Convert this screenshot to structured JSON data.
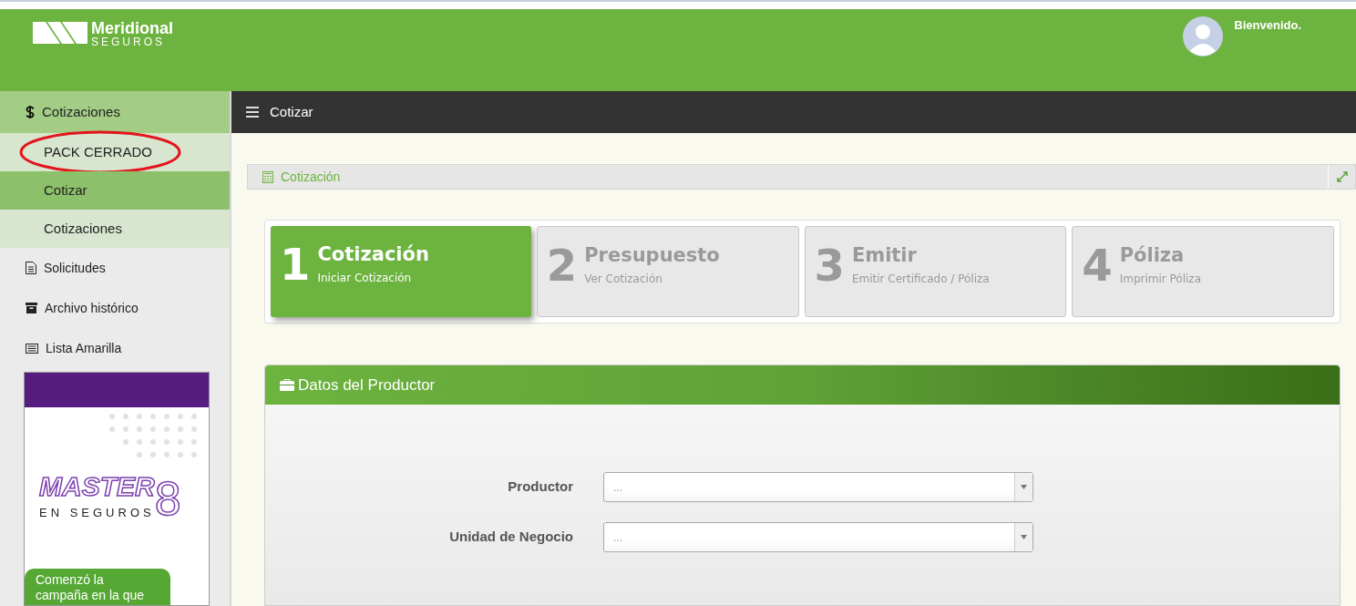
{
  "header": {
    "logo_name": "Meridional",
    "logo_sub": "SEGUROS",
    "greeting": "Bienvenido."
  },
  "sidebar": {
    "items": [
      {
        "kind": "group",
        "label": "Cotizaciones",
        "selected": false
      },
      {
        "kind": "sub",
        "label": "PACK CERRADO",
        "selected": false,
        "circled": true
      },
      {
        "kind": "sub",
        "label": "Cotizar",
        "selected": true,
        "circled": false
      },
      {
        "kind": "sub",
        "label": "Cotizaciones",
        "selected": false,
        "circled": false
      },
      {
        "kind": "item",
        "label": "Solicitudes",
        "selected": false
      },
      {
        "kind": "item",
        "label": "Archivo histórico",
        "selected": false
      },
      {
        "kind": "item",
        "label": "Lista Amarilla",
        "selected": false
      }
    ],
    "banner": {
      "title": "MASTER",
      "number": "8",
      "subtitle": "EN SEGUROS",
      "message": "Comenzó la campaña en la que"
    }
  },
  "toolbar": {
    "title": "Cotizar"
  },
  "panel": {
    "title": "Cotización",
    "steps": [
      {
        "number": "1",
        "title": "Cotización",
        "subtitle": "Iniciar Cotización",
        "selected": true
      },
      {
        "number": "2",
        "title": "Presupuesto",
        "subtitle": "Ver Cotización",
        "selected": false
      },
      {
        "number": "3",
        "title": "Emitir",
        "subtitle": "Emitir Certificado / Póliza",
        "selected": false
      },
      {
        "number": "4",
        "title": "Póliza",
        "subtitle": "Imprimir Póliza",
        "selected": false
      }
    ]
  },
  "form": {
    "title": "Datos del Productor",
    "fields": [
      {
        "label": "Productor",
        "placeholder": "..."
      },
      {
        "label": "Unidad de Negocio",
        "placeholder": "..."
      }
    ]
  }
}
